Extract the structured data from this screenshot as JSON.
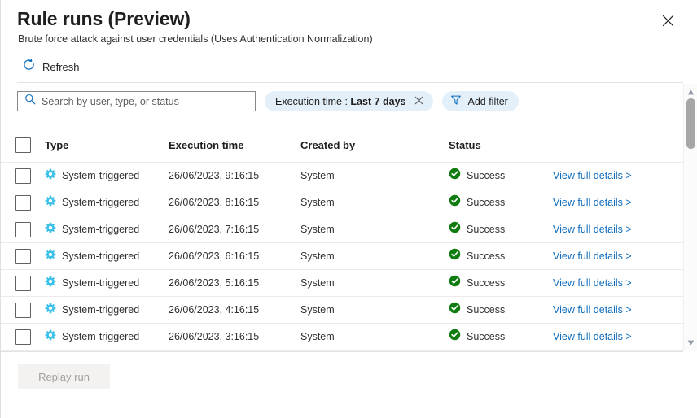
{
  "panel": {
    "title": "Rule runs (Preview)",
    "subtitle": "Brute force attack against user credentials (Uses Authentication Normalization)",
    "close_label": "Close"
  },
  "commandbar": {
    "refresh_label": "Refresh"
  },
  "search": {
    "placeholder": "Search by user, type, or status",
    "value": ""
  },
  "filters": {
    "execution_time": {
      "prefix": "Execution time : ",
      "value": "Last 7 days",
      "remove_label": "Remove filter"
    },
    "add_filter_label": "Add filter"
  },
  "table": {
    "columns": [
      "Type",
      "Execution time",
      "Created by",
      "Status"
    ],
    "rows": [
      {
        "type": "System-triggered",
        "time": "26/06/2023, 9:16:15",
        "created_by": "System",
        "status": "Success",
        "action": "View full details >"
      },
      {
        "type": "System-triggered",
        "time": "26/06/2023, 8:16:15",
        "created_by": "System",
        "status": "Success",
        "action": "View full details >"
      },
      {
        "type": "System-triggered",
        "time": "26/06/2023, 7:16:15",
        "created_by": "System",
        "status": "Success",
        "action": "View full details >"
      },
      {
        "type": "System-triggered",
        "time": "26/06/2023, 6:16:15",
        "created_by": "System",
        "status": "Success",
        "action": "View full details >"
      },
      {
        "type": "System-triggered",
        "time": "26/06/2023, 5:16:15",
        "created_by": "System",
        "status": "Success",
        "action": "View full details >"
      },
      {
        "type": "System-triggered",
        "time": "26/06/2023, 4:16:15",
        "created_by": "System",
        "status": "Success",
        "action": "View full details >"
      },
      {
        "type": "System-triggered",
        "time": "26/06/2023, 3:16:15",
        "created_by": "System",
        "status": "Success",
        "action": "View full details >"
      }
    ]
  },
  "footer": {
    "replay_run_label": "Replay run"
  },
  "icons": {
    "refresh": "refresh-icon",
    "search": "search-icon",
    "filter": "filter-funnel-icon",
    "close": "close-icon",
    "type": "gear-icon",
    "status": "success-check-icon",
    "scroll_up": "scroll-up-arrow-icon",
    "scroll_down": "scroll-down-arrow-icon"
  },
  "colors": {
    "accent": "#0f6cbd",
    "success": "#107c10",
    "gear": "#3bc0e8",
    "pill_bg": "#e3f0fa",
    "border": "#edebe9"
  }
}
